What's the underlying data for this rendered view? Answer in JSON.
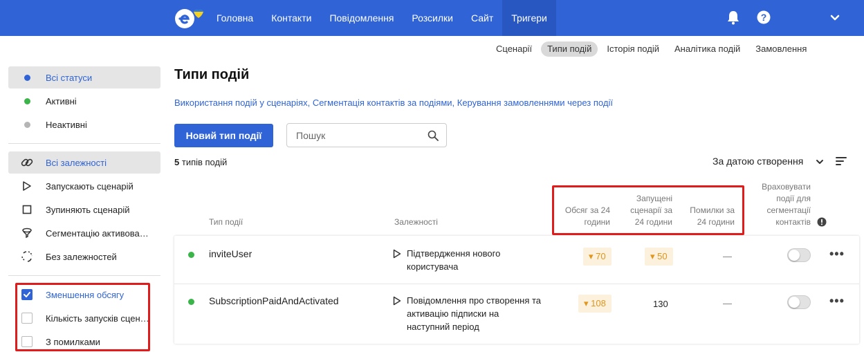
{
  "nav": {
    "items": [
      "Головна",
      "Контакти",
      "Повідомлення",
      "Розсилки",
      "Сайт",
      "Тригери"
    ],
    "active_index": 5,
    "accent_color": "#2f63d6"
  },
  "subtabs": {
    "items": [
      "Сценарії",
      "Типи подій",
      "Історія подій",
      "Аналітика подій",
      "Замовлення"
    ],
    "active_index": 1
  },
  "sidebar": {
    "statuses": [
      {
        "label": "Всі статуси",
        "color": "#2f63d6"
      },
      {
        "label": "Активні",
        "color": "#3bb54a"
      },
      {
        "label": "Неактивні",
        "color": "#b5b5b5"
      }
    ],
    "dependencies": [
      {
        "label": "Всі залежності",
        "icon": "link-icon"
      },
      {
        "label": "Запускають сценарій",
        "icon": "play-outline-icon"
      },
      {
        "label": "Зупиняють сценарій",
        "icon": "stop-outline-icon"
      },
      {
        "label": "Сегментацію активовано",
        "icon": "filter-icon"
      },
      {
        "label": "Без залежностей",
        "icon": "unlink-icon"
      }
    ],
    "filters": [
      {
        "label": "Зменшення обсягу",
        "checked": true
      },
      {
        "label": "Кількість запусків сценаріїв",
        "checked": false
      },
      {
        "label": "З помилками",
        "checked": false
      }
    ]
  },
  "page": {
    "title": "Типи подій",
    "links": [
      "Використання подій у сценаріях",
      "Сегментація контактів за подіями",
      "Керування замовленнями через події"
    ],
    "new_button": "Новий тип події",
    "search_placeholder": "Пошук",
    "count_number": "5",
    "count_label": "типів подій",
    "sort_label": "За датою створення"
  },
  "table": {
    "headers": {
      "type": "Тип події",
      "deps": "Залежності",
      "volume": [
        "Обсяг за 24",
        "години"
      ],
      "launched": [
        "Запущені",
        "сценарії за",
        "24 години"
      ],
      "errors": [
        "Помилки за",
        "24 години"
      ],
      "segm": [
        "Враховувати",
        "події для",
        "сегментації",
        "контактів"
      ]
    },
    "rows": [
      {
        "name": "inviteUser",
        "status_color": "#3bb54a",
        "dependency": [
          "Підтвердження нового",
          "користувача"
        ],
        "volume": "70",
        "launched": "50",
        "launched_badge": true,
        "errors": "—",
        "segmentation": false
      },
      {
        "name": "SubscriptionPaidAndActivated",
        "status_color": "#3bb54a",
        "dependency": [
          "Повідомлення про створення та",
          "активацію підписки на",
          "наступний період"
        ],
        "volume": "108",
        "launched": "130",
        "launched_badge": false,
        "errors": "—",
        "segmentation": false
      }
    ]
  }
}
